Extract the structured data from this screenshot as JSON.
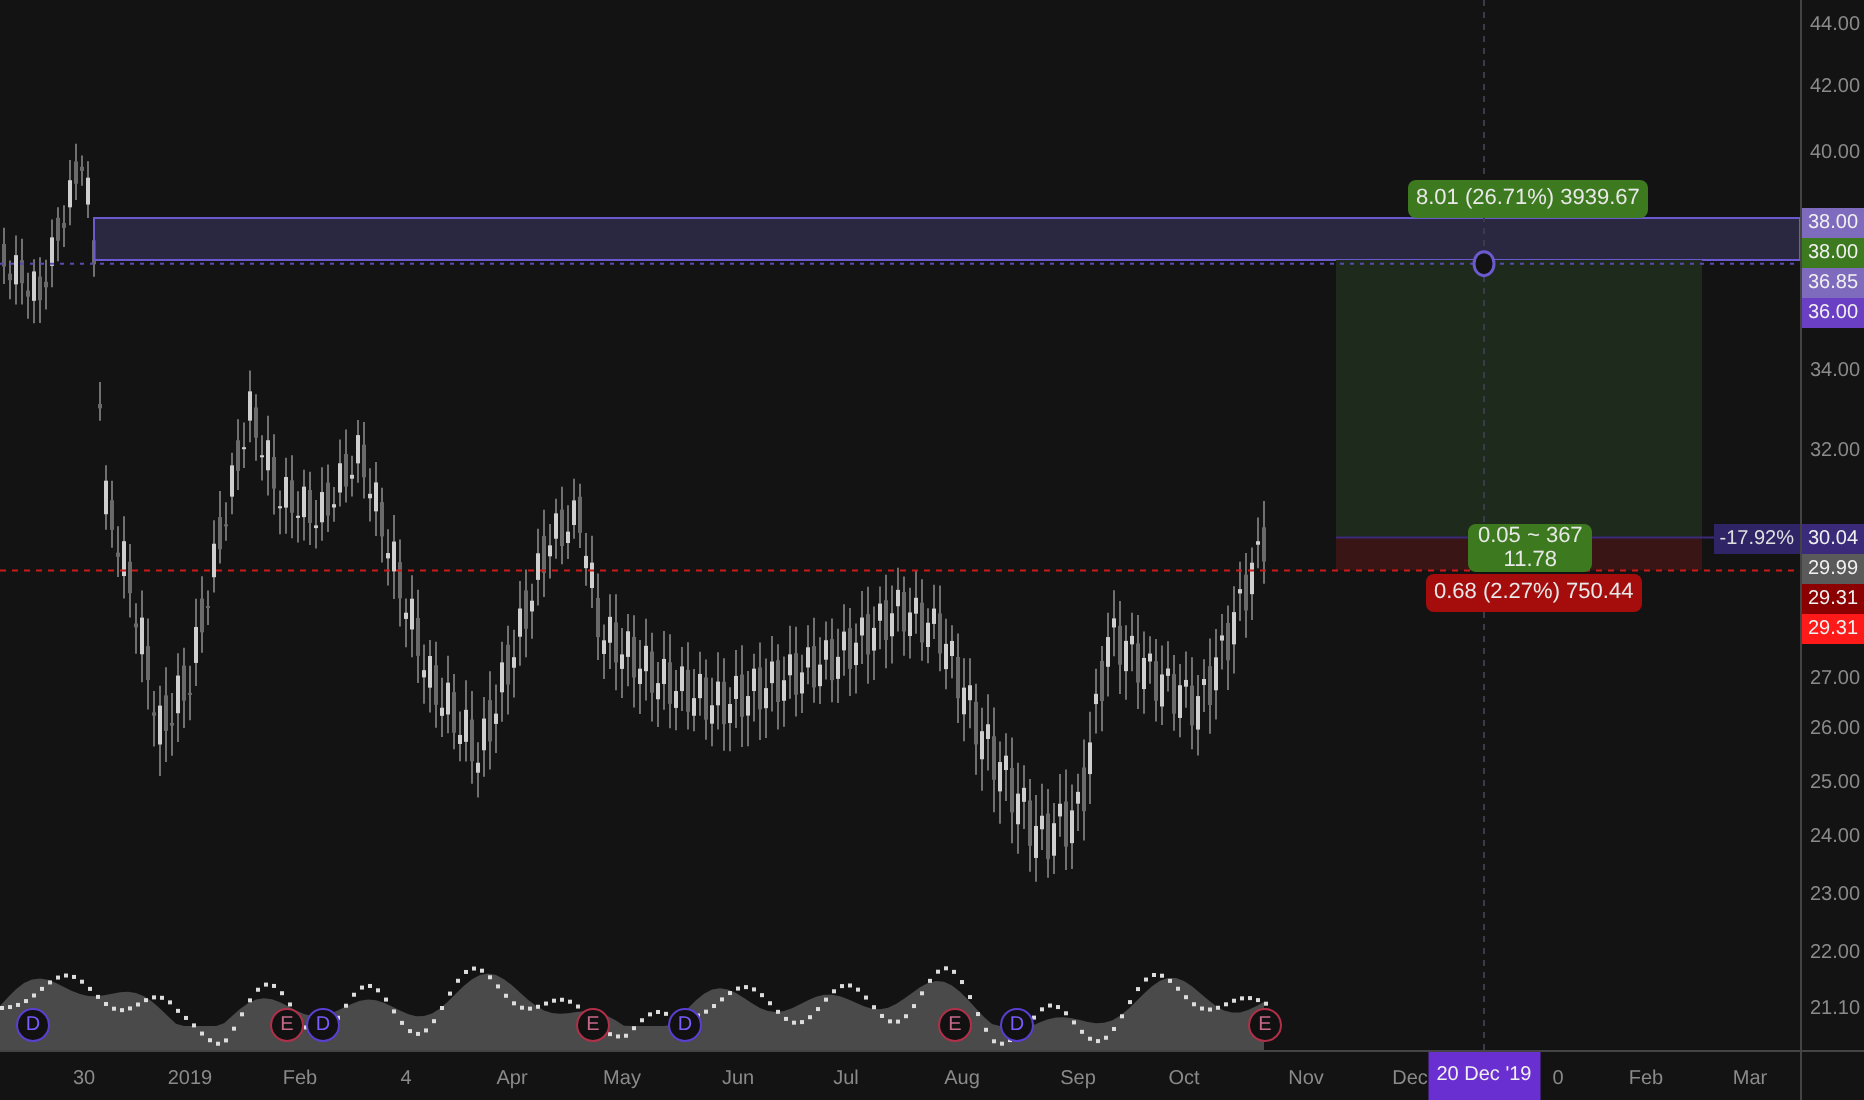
{
  "price_axis": {
    "ticks": [
      "44.00",
      "42.00",
      "40.00",
      "34.00",
      "32.00",
      "27.00",
      "26.00",
      "25.00",
      "24.00",
      "23.00",
      "22.00",
      "21.10"
    ],
    "tags": [
      {
        "text": "38.00",
        "color": "#7e6bbd"
      },
      {
        "text": "38.00",
        "color": "#3d7a1f"
      },
      {
        "text": "36.85",
        "color": "#7e6bbd"
      },
      {
        "text": "36.00",
        "color": "#6a3fc4"
      },
      {
        "text": "30.04",
        "color": "#3b2a7a"
      },
      {
        "text": "29.99",
        "color": "#5a5a5a"
      },
      {
        "text": "29.31",
        "color": "#8b0000"
      },
      {
        "text": "29.31",
        "color": "#ff1a1a"
      }
    ]
  },
  "change_tag": "-17.92%",
  "time_axis": {
    "ticks": [
      "30",
      "2019",
      "Feb",
      "4",
      "Apr",
      "May",
      "Jun",
      "Jul",
      "Aug",
      "Sep",
      "Oct",
      "Nov",
      "Dec",
      "0",
      "Feb",
      "Mar"
    ],
    "cursor_date": "20 Dec '19"
  },
  "events": [
    {
      "letter": "D",
      "kind": "dividend"
    },
    {
      "letter": "E",
      "kind": "earnings"
    },
    {
      "letter": "D",
      "kind": "dividend"
    },
    {
      "letter": "E",
      "kind": "earnings"
    },
    {
      "letter": "D",
      "kind": "dividend"
    },
    {
      "letter": "E",
      "kind": "earnings"
    },
    {
      "letter": "D",
      "kind": "dividend"
    },
    {
      "letter": "E",
      "kind": "earnings"
    }
  ],
  "position": {
    "target_label": "8.01 (26.71%) 3939.67",
    "center_lines": [
      "0.05 ~ 367",
      "11.78"
    ],
    "stop_label": "0.68 (2.27%) 750.44"
  }
}
